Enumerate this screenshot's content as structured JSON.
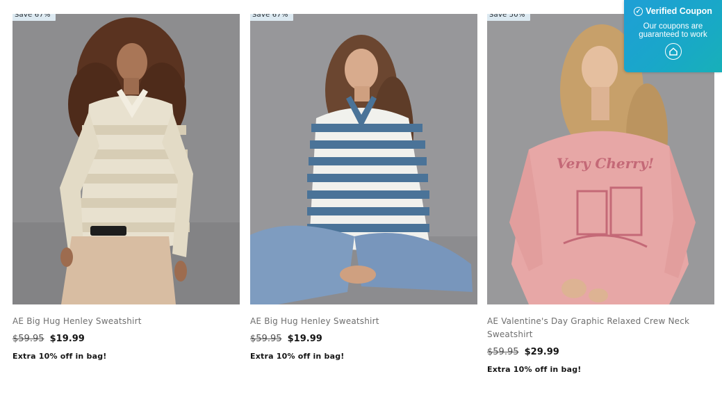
{
  "products": [
    {
      "badge": "Save 67%",
      "title": "AE Big Hug Henley Sweatshirt",
      "original_price": "$59.95",
      "sale_price": "$19.99",
      "promo": "Extra 10% off in bag!",
      "image_desc": "model-cream-striped-henley"
    },
    {
      "badge": "Save 67%",
      "title": "AE Big Hug Henley Sweatshirt",
      "original_price": "$59.95",
      "sale_price": "$19.99",
      "promo": "Extra 10% off in bag!",
      "image_desc": "model-blue-striped-henley"
    },
    {
      "badge": "Save 50%",
      "title": "AE Valentine's Day Graphic Relaxed Crew Neck Sweatshirt",
      "original_price": "$59.95",
      "sale_price": "$29.99",
      "promo": "Extra 10% off in bag!",
      "image_desc": "model-pink-very-cherry-sweatshirt"
    }
  ],
  "image_text": {
    "graphic_print": "Very Cherry!"
  },
  "coupon_widget": {
    "title": "Verified Coupon",
    "message": "Our coupons are guaranteed to work",
    "icons": [
      "check-circle-icon",
      "brand-logo-icon"
    ]
  },
  "colors": {
    "badge_bg": "#dce9f1",
    "coupon_gradient_start": "#1f9fd6",
    "coupon_gradient_end": "#17b0b9",
    "photo_bg": "#8a8a8c"
  }
}
